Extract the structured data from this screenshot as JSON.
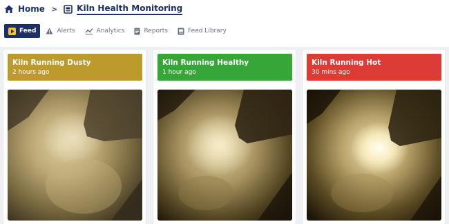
{
  "breadcrumb": {
    "home_label": "Home",
    "separator": ">",
    "current_label": "Kiln Health Monitoring"
  },
  "tabs": [
    {
      "label": "Feed",
      "icon": "play-icon",
      "active": true
    },
    {
      "label": "Alerts",
      "icon": "warning-icon",
      "active": false
    },
    {
      "label": "Analytics",
      "icon": "analytics-icon",
      "active": false
    },
    {
      "label": "Reports",
      "icon": "reports-icon",
      "active": false
    },
    {
      "label": "Feed Library",
      "icon": "library-icon",
      "active": false
    }
  ],
  "cards": [
    {
      "title": "Kiln Running Dusty",
      "time": "2 hours ago",
      "color": "#bd9a2c",
      "status": "dusty"
    },
    {
      "title": "Kiln Running Healthy",
      "time": "1 hour ago",
      "color": "#35a637",
      "status": "healthy"
    },
    {
      "title": "Kiln Running Hot",
      "time": "30 mins ago",
      "color": "#dc3b36",
      "status": "hot"
    }
  ],
  "colors": {
    "brand_navy": "#1d2f6a",
    "tab_inactive": "#6b7185",
    "background": "#eef0f3"
  }
}
